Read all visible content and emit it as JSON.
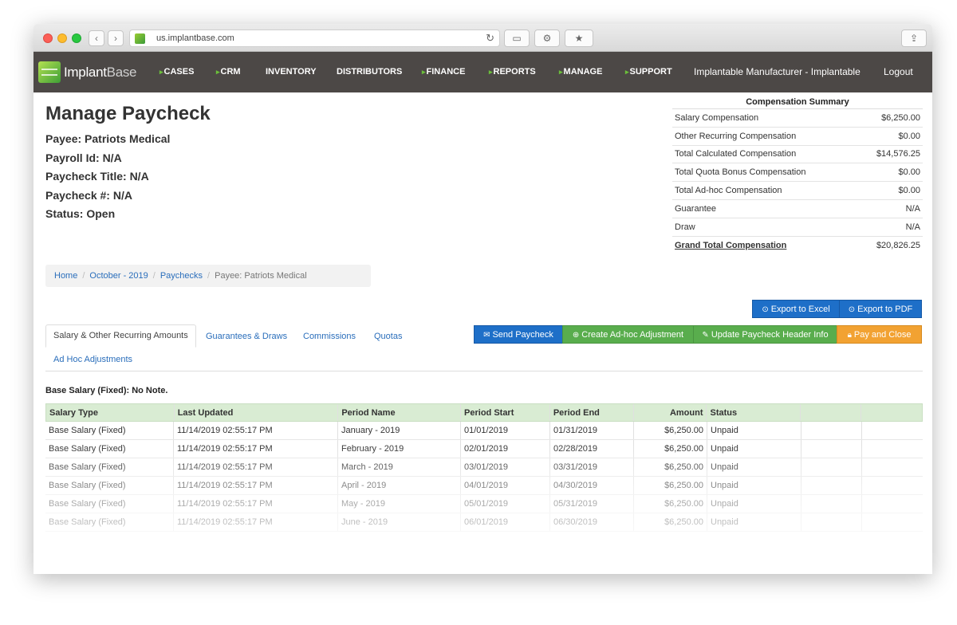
{
  "browser": {
    "url": "us.implantbase.com"
  },
  "nav": {
    "logo_main": "Implant",
    "logo_sub": "Base",
    "items": [
      "CASES",
      "CRM",
      "INVENTORY",
      "DISTRIBUTORS",
      "FINANCE",
      "REPORTS",
      "MANAGE",
      "SUPPORT"
    ],
    "account": "Implantable Manufacturer - Implantable",
    "logout": "Logout"
  },
  "header": {
    "title": "Manage Paycheck",
    "payee": "Payee: Patriots Medical",
    "payroll_id": "Payroll Id: N/A",
    "paycheck_title": "Paycheck Title: N/A",
    "paycheck_number": "Paycheck #: N/A",
    "status": "Status: Open"
  },
  "summary": {
    "title": "Compensation Summary",
    "rows": [
      {
        "label": "Salary Compensation",
        "value": "$6,250.00"
      },
      {
        "label": "Other Recurring Compensation",
        "value": "$0.00"
      },
      {
        "label": "Total Calculated Compensation",
        "value": "$14,576.25"
      },
      {
        "label": "Total Quota Bonus Compensation",
        "value": "$0.00"
      },
      {
        "label": "Total Ad-hoc Compensation",
        "value": "$0.00"
      },
      {
        "label": "Guarantee",
        "value": "N/A"
      },
      {
        "label": "Draw",
        "value": "N/A"
      }
    ],
    "grand_label": "Grand Total Compensation",
    "grand_value": "$20,826.25"
  },
  "breadcrumb": {
    "home": "Home",
    "period": "October - 2019",
    "paychecks": "Paychecks",
    "current": "Payee: Patriots Medical"
  },
  "actions": {
    "export_excel": "Export to Excel",
    "export_pdf": "Export to PDF",
    "send": "Send Paycheck",
    "adhoc": "Create Ad-hoc Adjustment",
    "update_header": "Update Paycheck Header Info",
    "pay_close": "Pay and Close"
  },
  "tabs": {
    "salary": "Salary & Other Recurring Amounts",
    "guarantees": "Guarantees & Draws",
    "commissions": "Commissions",
    "quotas": "Quotas",
    "adhoc": "Ad Hoc Adjustments"
  },
  "note": "Base Salary (Fixed): No Note.",
  "table": {
    "headers": [
      "Salary Type",
      "Last Updated",
      "Period Name",
      "Period Start",
      "Period End",
      "Amount",
      "Status",
      "",
      ""
    ],
    "rows": [
      [
        "Base Salary (Fixed)",
        "11/14/2019 02:55:17 PM",
        "January - 2019",
        "01/01/2019",
        "01/31/2019",
        "$6,250.00",
        "Unpaid"
      ],
      [
        "Base Salary (Fixed)",
        "11/14/2019 02:55:17 PM",
        "February - 2019",
        "02/01/2019",
        "02/28/2019",
        "$6,250.00",
        "Unpaid"
      ],
      [
        "Base Salary (Fixed)",
        "11/14/2019 02:55:17 PM",
        "March - 2019",
        "03/01/2019",
        "03/31/2019",
        "$6,250.00",
        "Unpaid"
      ],
      [
        "Base Salary (Fixed)",
        "11/14/2019 02:55:17 PM",
        "April - 2019",
        "04/01/2019",
        "04/30/2019",
        "$6,250.00",
        "Unpaid"
      ],
      [
        "Base Salary (Fixed)",
        "11/14/2019 02:55:17 PM",
        "May - 2019",
        "05/01/2019",
        "05/31/2019",
        "$6,250.00",
        "Unpaid"
      ],
      [
        "Base Salary (Fixed)",
        "11/14/2019 02:55:17 PM",
        "June - 2019",
        "06/01/2019",
        "06/30/2019",
        "$6,250.00",
        "Unpaid"
      ]
    ]
  }
}
